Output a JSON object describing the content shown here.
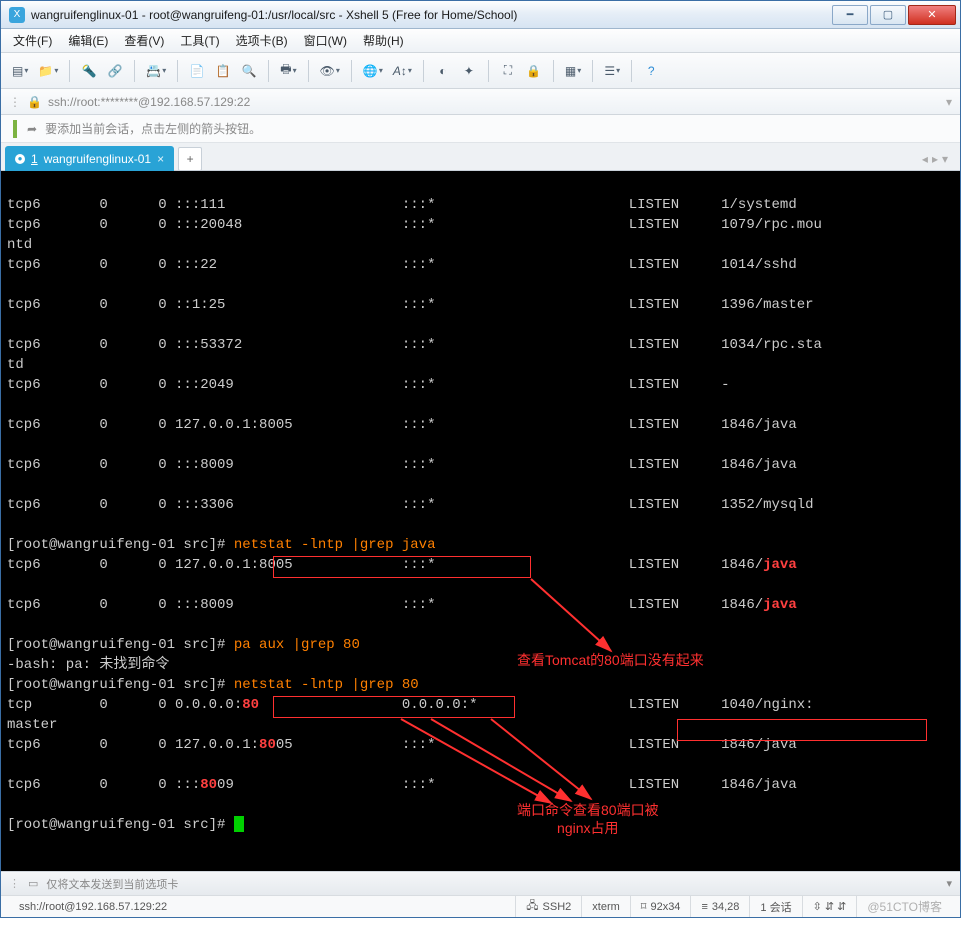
{
  "window": {
    "title": "wangruifenglinux-01 - root@wangruifeng-01:/usr/local/src - Xshell 5 (Free for Home/School)"
  },
  "menu": {
    "file": "文件(F)",
    "edit": "编辑(E)",
    "view": "查看(V)",
    "tools": "工具(T)",
    "tabs": "选项卡(B)",
    "window": "窗口(W)",
    "help": "帮助(H)"
  },
  "toolbar_icons": {
    "new": "new-session",
    "open": "open",
    "reload": "reconnect",
    "cut": "cut",
    "props": "properties",
    "copy": "copy",
    "paste": "paste",
    "find": "find",
    "print": "print",
    "zoom": "view",
    "globe": "language",
    "font": "font",
    "color": "color-scheme",
    "hl": "highlight",
    "full": "full-screen",
    "lock": "lock",
    "tile": "tile",
    "opt": "options",
    "help": "help"
  },
  "address": {
    "lock": "🔒",
    "text": "ssh://root:********@192.168.57.129:22"
  },
  "info": {
    "arrow": "➦",
    "text": "要添加当前会话，点击左侧的箭头按钮。"
  },
  "tabs": {
    "active_num": "1",
    "active_label": "wangruifenglinux-01",
    "close": "×",
    "add": "+"
  },
  "term": {
    "rows": [
      {
        "proto": "tcp6",
        "recv": "0",
        "send": "0",
        "local": ":::111",
        "foreign": ":::*",
        "state": "LISTEN",
        "pid": "1/systemd"
      },
      {
        "proto": "tcp6",
        "recv": "0",
        "send": "0",
        "local": ":::20048",
        "foreign": ":::*",
        "state": "LISTEN",
        "pid": "1079/rpc.mou"
      },
      {
        "wrap": "ntd"
      },
      {
        "proto": "tcp6",
        "recv": "0",
        "send": "0",
        "local": ":::22",
        "foreign": ":::*",
        "state": "LISTEN",
        "pid": "1014/sshd"
      },
      {
        "blank": true
      },
      {
        "proto": "tcp6",
        "recv": "0",
        "send": "0",
        "local": "::1:25",
        "foreign": ":::*",
        "state": "LISTEN",
        "pid": "1396/master"
      },
      {
        "blank": true
      },
      {
        "proto": "tcp6",
        "recv": "0",
        "send": "0",
        "local": ":::53372",
        "foreign": ":::*",
        "state": "LISTEN",
        "pid": "1034/rpc.sta"
      },
      {
        "wrap": "td"
      },
      {
        "proto": "tcp6",
        "recv": "0",
        "send": "0",
        "local": ":::2049",
        "foreign": ":::*",
        "state": "LISTEN",
        "pid": "-"
      },
      {
        "blank": true
      },
      {
        "proto": "tcp6",
        "recv": "0",
        "send": "0",
        "local": "127.0.0.1:8005",
        "foreign": ":::*",
        "state": "LISTEN",
        "pid": "1846/java"
      },
      {
        "blank": true
      },
      {
        "proto": "tcp6",
        "recv": "0",
        "send": "0",
        "local": ":::8009",
        "foreign": ":::*",
        "state": "LISTEN",
        "pid": "1846/java"
      },
      {
        "blank": true
      },
      {
        "proto": "tcp6",
        "recv": "0",
        "send": "0",
        "local": ":::3306",
        "foreign": ":::*",
        "state": "LISTEN",
        "pid": "1352/mysqld"
      }
    ],
    "prompt1_pre": "[root@wangruifeng-01 src]# ",
    "cmd1": "netstat -lntp |grep java",
    "r_jav1": {
      "proto": "tcp6",
      "recv": "0",
      "send": "0",
      "local": "127.0.0.1:8005",
      "foreign": ":::*",
      "state": "LISTEN",
      "pidpre": "1846/",
      "pidhl": "java"
    },
    "r_jav2": {
      "proto": "tcp6",
      "recv": "0",
      "send": "0",
      "local": ":::8009",
      "foreign": ":::*",
      "state": "LISTEN",
      "pidpre": "1846/",
      "pidhl": "java"
    },
    "prompt2_pre": "[root@wangruifeng-01 src]# ",
    "cmd2": "pa aux |grep 80",
    "err": "-bash: pa: 未找到命令",
    "prompt3_pre": "[root@wangruifeng-01 src]# ",
    "cmd3": "netstat -lntp |grep 80",
    "r80a": {
      "proto": "tcp",
      "recv": "0",
      "send": "0",
      "local_pre": "0.0.0.0:",
      "local_hl": "80",
      "foreign": "0.0.0.0:*",
      "state": "LISTEN",
      "pid": "1040/nginx: "
    },
    "r80a_wrap": "master",
    "r80b": {
      "proto": "tcp6",
      "recv": "0",
      "send": "0",
      "local_pre": "127.0.0.1:",
      "local_hl": "80",
      "local_post": "05",
      "foreign": ":::*",
      "state": "LISTEN",
      "pid": "1846/java"
    },
    "r80c": {
      "proto": "tcp6",
      "recv": "0",
      "send": "0",
      "local_pre": ":::",
      "local_hl": "80",
      "local_post": "09",
      "foreign": ":::*",
      "state": "LISTEN",
      "pid": "1846/java"
    },
    "prompt4_pre": "[root@wangruifeng-01 src]# "
  },
  "annotations": {
    "a1": "查看Tomcat的80端口没有起来",
    "a2_l1": "端口命令查看80端口被",
    "a2_l2": "nginx占用"
  },
  "bottom": {
    "text": "仅将文本发送到当前选项卡"
  },
  "status": {
    "conn": "ssh://root@192.168.57.129:22",
    "proto": "SSH2",
    "term": "xterm",
    "size_lbl": "⌑",
    "size": "92x34",
    "rc_lbl": "≡",
    "rc": "34,28",
    "sess": "1 会话",
    "caps": "⇳ ⇵ ⇵"
  },
  "watermark": "@51CTO博客"
}
